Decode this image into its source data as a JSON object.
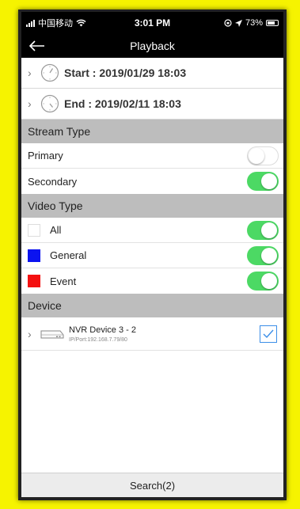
{
  "status_bar": {
    "carrier": "中国移动",
    "time": "3:01 PM",
    "battery": "73%"
  },
  "nav": {
    "title": "Playback"
  },
  "time_range": {
    "start": "Start : 2019/01/29 18:03",
    "end": "End : 2019/02/11 18:03"
  },
  "stream_type": {
    "header": "Stream Type",
    "items": [
      {
        "label": "Primary",
        "enabled": false
      },
      {
        "label": "Secondary",
        "enabled": true
      }
    ]
  },
  "video_type": {
    "header": "Video Type",
    "items": [
      {
        "label": "All",
        "color": "#ffffff",
        "enabled": true
      },
      {
        "label": "General",
        "color": "#0b13f0",
        "enabled": true
      },
      {
        "label": "Event",
        "color": "#f41010",
        "enabled": true
      }
    ]
  },
  "device": {
    "header": "Device",
    "items": [
      {
        "name": "NVR Device 3 - 2",
        "address": "IP/Port:192.168.7.79/80",
        "checked": true
      }
    ]
  },
  "footer": {
    "search_label": "Search(2)"
  },
  "colors": {
    "toggle_on": "#4cd964",
    "section_bg": "#bdbdbd",
    "frame_bg": "#f6f300",
    "checkbox": "#3b8ee8"
  }
}
